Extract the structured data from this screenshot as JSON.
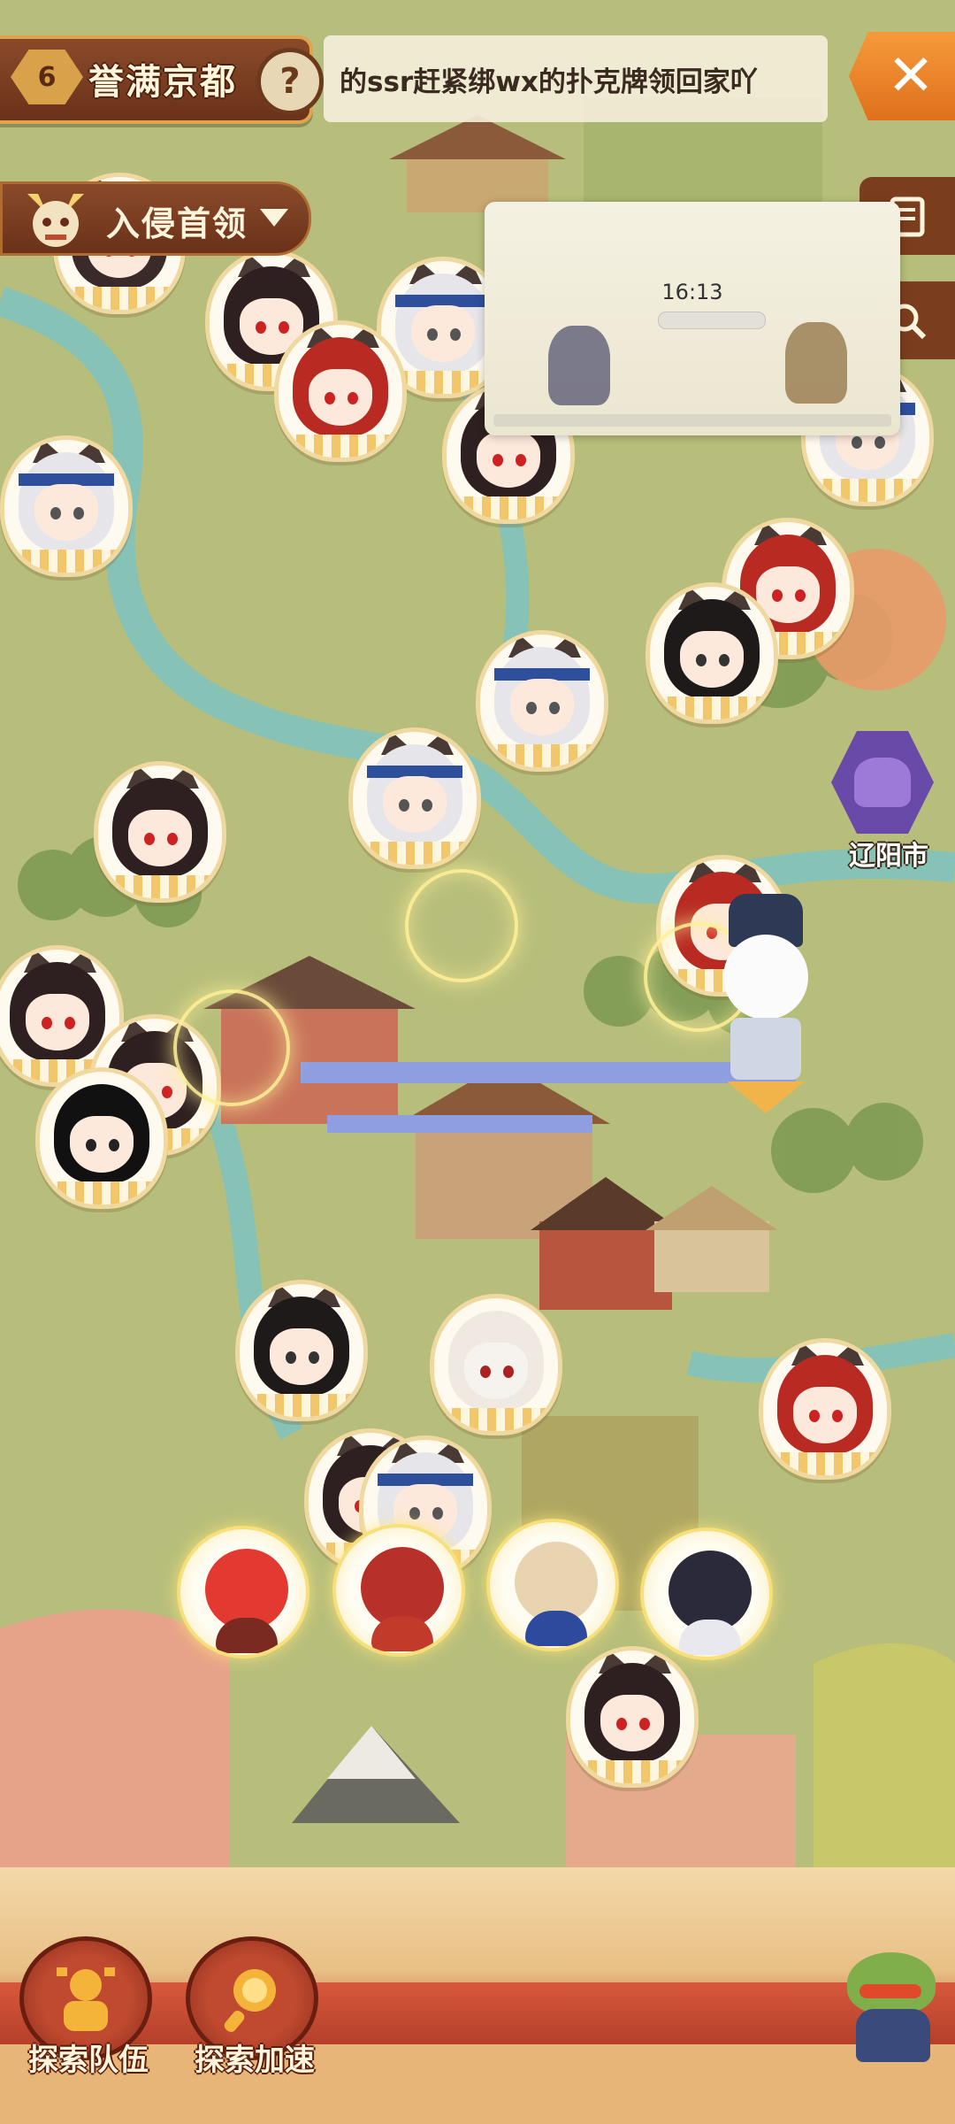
{
  "hud": {
    "level": "6",
    "region_title": "誉满京都",
    "help_symbol": "?",
    "marquee_text": "的ssr赶紧绑wx的扑克牌领回家吖",
    "close_symbol": "✕",
    "invader_label": "入侵首领"
  },
  "overlay": {
    "time": "16:13"
  },
  "map": {
    "city_label": "辽阳市"
  },
  "bottom_bar": {
    "team_label": "探索队伍",
    "speed_label": "探索加速"
  },
  "icons": {
    "close": "close-icon",
    "help": "question-icon",
    "invader": "demon-mask-icon",
    "list": "list-icon",
    "search": "search-icon",
    "team": "team-icon",
    "speed": "magnifier-icon"
  },
  "colors": {
    "map_green": "#b8bf7c",
    "river": "#7fbfb5",
    "plaque_brown": "#7a3e1e",
    "gold": "#e0a44a",
    "orange_close": "#f08a2c",
    "bottom_red": "#c04a30"
  }
}
